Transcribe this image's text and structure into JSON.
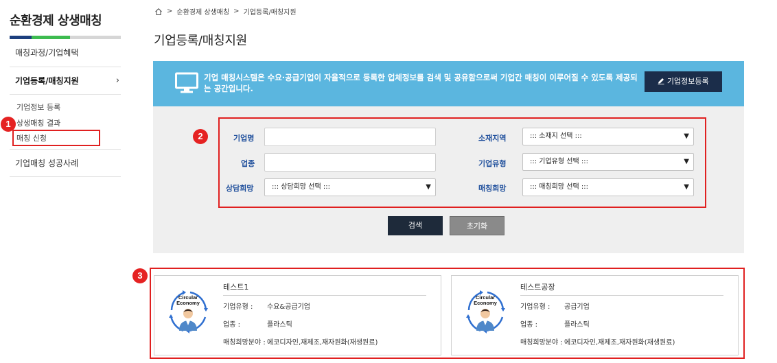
{
  "sidebar": {
    "title": "순환경제 상생매칭",
    "items": [
      {
        "label": "매칭과정/기업혜택"
      },
      {
        "label": "기업등록/매칭지원",
        "chevron": "›"
      },
      {
        "label": "기업매칭 성공사례"
      }
    ],
    "sub_items": [
      {
        "label": "기업정보 등록"
      },
      {
        "label": "상생매칭 결과"
      },
      {
        "label": "매칭 신청"
      }
    ]
  },
  "annotations": [
    "1",
    "2",
    "3"
  ],
  "breadcrumb": {
    "separator": ">",
    "items": [
      "순환경제 상생매칭",
      "기업등록/매칭지원"
    ]
  },
  "page_title": "기업등록/매칭지원",
  "banner": {
    "text": "기업 매칭시스템은 수요·공급기업이 자율적으로 등록한 업체정보를 검색 및 공유함으로써 기업간 매칭이 이루어질 수 있도록 제공되는 공간입니다.",
    "register_button": "기업정보등록",
    "register_icon": "pencil-icon",
    "colors": {
      "banner": "#5bb6df",
      "button": "#1b2d4a"
    }
  },
  "search": {
    "company_name_label": "기업명",
    "industry_label": "업종",
    "consult_label": "상담희망",
    "consult_select": "::: 상담희망 선택 :::",
    "location_label": "소재지역",
    "location_select": "::: 소재지 선택 :::",
    "type_label": "기업유형",
    "type_select": "::: 기업유형 선택 :::",
    "matching_label": "매칭희망",
    "matching_select": "::: 매칭희망 선택 :::",
    "search_button": "검색",
    "reset_button": "초기화",
    "label_color": "#1f4f9c"
  },
  "results": [
    {
      "name": "테스트1",
      "logo_text": [
        "Circular",
        "Economy"
      ],
      "type_label": "기업유형 :",
      "type_value": "수요&공급기업",
      "industry_label": "업종 :",
      "industry_value": "플라스틱",
      "matching_label": "매칭희망분야 :",
      "matching_value": "에코디자인,재제조,재자원화(재생원료)"
    },
    {
      "name": "테스트공장",
      "logo_text": [
        "Circular",
        "Economy"
      ],
      "type_label": "기업유형 :",
      "type_value": "공급기업",
      "industry_label": "업종 :",
      "industry_value": "플라스틱",
      "matching_label": "매칭희망분야 :",
      "matching_value": "에코디자인,재제조,재자원화(재생원료)"
    }
  ]
}
